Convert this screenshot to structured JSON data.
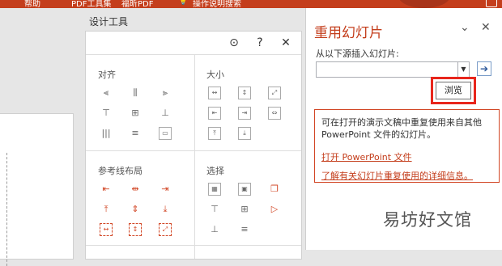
{
  "ribbon": {
    "tabs": [
      "帮助",
      "PDF工具集",
      "福昕PDF",
      "操作说明搜索"
    ]
  },
  "design_panel": {
    "title": "设计工具",
    "toolbar_icons": [
      "target-icon",
      "help-icon",
      "close-icon"
    ],
    "sections": {
      "align": "对齐",
      "size": "大小",
      "guides": "参考线布局",
      "select": "选择"
    }
  },
  "reuse_panel": {
    "title": "重用幻灯片",
    "source_label": "从以下源插入幻灯片:",
    "source_value": "",
    "browse_label": "浏览",
    "info_text": "可在打开的演示文稿中重复使用来自其他 PowerPoint 文件的幻灯片。",
    "link_open": "打开 PowerPoint 文件",
    "link_learn": "了解有关幻灯片重复使用的详细信息。"
  },
  "watermark": "易坊好文馆",
  "colors": {
    "accent": "#c43e1c",
    "highlight": "#e8261c",
    "link": "#c43e1c"
  }
}
